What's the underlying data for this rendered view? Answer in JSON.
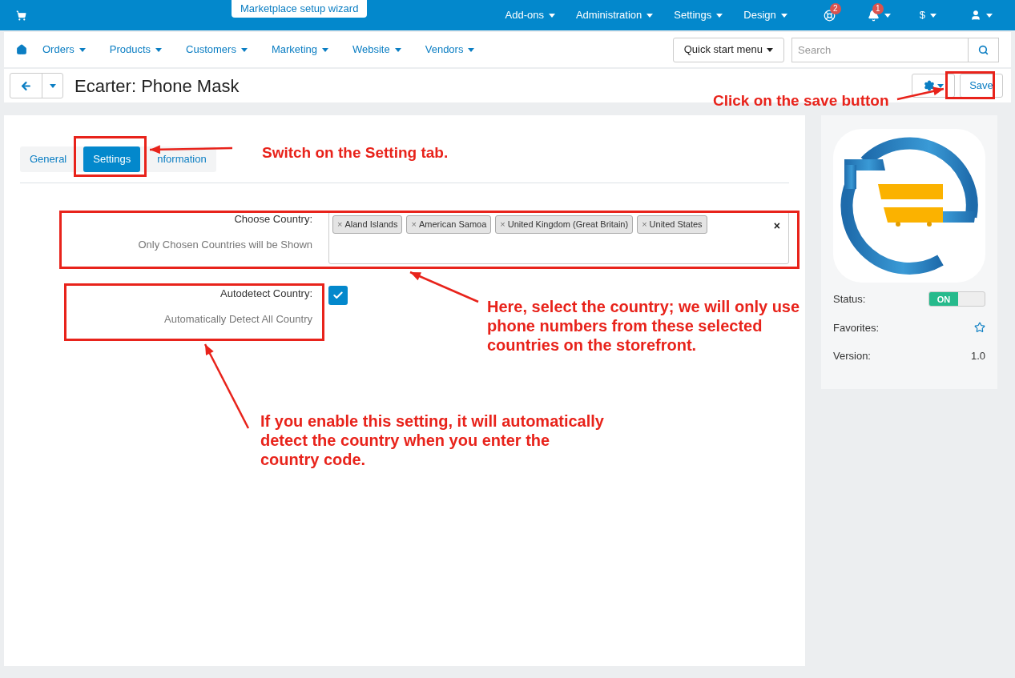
{
  "top_bar": {
    "wizard": "Marketplace setup wizard",
    "menus": [
      {
        "label": "Add-ons"
      },
      {
        "label": "Administration"
      },
      {
        "label": "Settings"
      },
      {
        "label": "Design"
      }
    ],
    "help_badge": "2",
    "bell_badge": "1",
    "currency": "$"
  },
  "nav": {
    "items": [
      {
        "label": "Orders"
      },
      {
        "label": "Products"
      },
      {
        "label": "Customers"
      },
      {
        "label": "Marketing"
      },
      {
        "label": "Website"
      },
      {
        "label": "Vendors"
      }
    ],
    "quick_start": "Quick start menu",
    "search": {
      "placeholder": "Search"
    }
  },
  "title_bar": {
    "title": "Ecarter: Phone Mask",
    "save": "Save"
  },
  "tabs": [
    {
      "label": "General",
      "selected": false
    },
    {
      "label": "Settings",
      "selected": true
    },
    {
      "label": "nformation",
      "selected": false
    }
  ],
  "fields": [
    {
      "kind": "multiselect",
      "label": "Choose Country:",
      "hint": "Only Chosen Countries will be Shown",
      "clear": "×",
      "tags": [
        {
          "remove": "×",
          "label": "Aland Islands"
        },
        {
          "remove": "×",
          "label": "American Samoa"
        },
        {
          "remove": "×",
          "label": "United Kingdom (Great Britain)"
        },
        {
          "remove": "×",
          "label": "United States"
        }
      ]
    },
    {
      "kind": "checkbox",
      "label": "Autodetect Country:",
      "hint": "Automatically Detect All Country",
      "checked": true
    }
  ],
  "sidebar": {
    "status_label": "Status:",
    "status": {
      "text": "ON",
      "on": true
    },
    "favorites_label": "Favorites:",
    "version_label": "Version:",
    "version": "1.0"
  },
  "callouts": {
    "tab": "Switch on the Setting tab.",
    "save": "Click on the save button",
    "country": "Here, select the country; we will only use phone numbers from these selected countries on the storefront.",
    "autodetect": "If you enable this setting, it will automatically detect the country when you enter the country code."
  }
}
